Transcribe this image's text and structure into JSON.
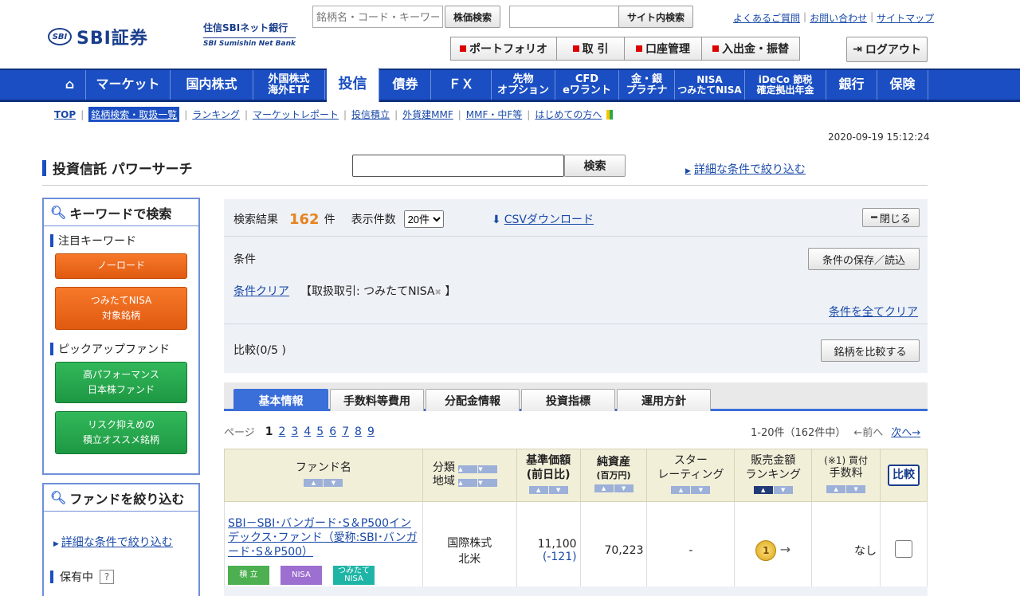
{
  "header": {
    "brand": "SBI証券",
    "brand_mark": "SBI",
    "bank_name": "住信SBIネット銀行",
    "bank_sub": "SBI Sumishin Net Bank",
    "stock_search_placeholder": "銘柄名・コード・キーワード",
    "stock_search_button": "株価検索",
    "site_search_button": "サイト内検索",
    "links": [
      "よくあるご質問",
      "お問い合わせ",
      "サイトマップ"
    ],
    "actions": [
      "ポートフォリオ",
      "取 引",
      "口座管理",
      "入出金・振替"
    ],
    "logout": "ログアウト"
  },
  "nav": {
    "items": [
      {
        "label": "マーケット"
      },
      {
        "label": "国内株式"
      },
      {
        "label": "外国株式\n海外ETF"
      },
      {
        "label": "投信"
      },
      {
        "label": "債券"
      },
      {
        "label": "ＦＸ"
      },
      {
        "label": "先物\nオプション"
      },
      {
        "label": "CFD\neワラント"
      },
      {
        "label": "金・銀\nプラチナ"
      },
      {
        "label": "NISA\nつみたてNISA"
      },
      {
        "label": "iDeCo 節税\n確定拠出年金"
      },
      {
        "label": "銀行"
      },
      {
        "label": "保険"
      }
    ],
    "sub": [
      "TOP",
      "銘柄検索・取扱一覧",
      "ランキング",
      "マーケットレポート",
      "投信積立",
      "外貨建MMF",
      "MMF・中F等",
      "はじめての方へ"
    ]
  },
  "timestamp": "2020-09-19 15:12:24",
  "page_title": "投資信託 パワーサーチ",
  "search_button": "検索",
  "detail_link": "詳細な条件で絞り込む",
  "left": {
    "keyword_title": "キーワードで検索",
    "hot_keywords": "注目キーワード",
    "orange_buttons": [
      "ノーロード",
      "つみたてNISA\n対象銘柄"
    ],
    "pickup": "ピックアップファンド",
    "green_buttons": [
      "高パフォーマンス\n日本株ファンド",
      "リスク抑えめの\n積立オススメ銘柄"
    ],
    "filter_title": "ファンドを絞り込む",
    "filter_link": "詳細な条件で絞り込む",
    "holding": "保有中",
    "holding_help": "?"
  },
  "conditions": {
    "result_label": "検索結果",
    "result_count": "162",
    "result_unit": "件",
    "per_page_label": "表示件数",
    "per_page_value": "20件",
    "csv": "CSVダウンロード",
    "close": "閉じる",
    "cond_label": "条件",
    "save_load": "条件の保存／読込",
    "clear": "条件クリア",
    "tag": "【取扱取引: つみたてNISA",
    "tag_end": "】",
    "clear_all": "条件を全てクリア",
    "compare_label": "比較(0/5 )",
    "compare_button": "銘柄を比較する"
  },
  "tabs": [
    "基本情報",
    "手数料等費用",
    "分配金情報",
    "投資指標",
    "運用方針"
  ],
  "pager": {
    "label": "ページ",
    "pages": [
      "1",
      "2",
      "3",
      "4",
      "5",
      "6",
      "7",
      "8",
      "9"
    ],
    "info": "1-20件（162件中）",
    "prev": "←前へ",
    "next": "次へ→"
  },
  "table": {
    "headers": {
      "fund": "ファンド名",
      "cat1": "分類",
      "cat2": "地域",
      "nav1": "基準価額",
      "nav2": "(前日比)",
      "assets1": "純資産",
      "assets2": "(百万円)",
      "star1": "スター",
      "star2": "レーティング",
      "rank1": "販売金額",
      "rank2": "ランキング",
      "fee1": "(※1) 買付",
      "fee2": "手数料",
      "compare": "比較"
    },
    "rows": [
      {
        "fund": "SBI－SBI･バンガード･S＆P500インデックス･ファンド（愛称:SBI･バンガード･S＆P500）",
        "badges": [
          "積 立",
          "NISA",
          "つみたて\nNISA"
        ],
        "cat": "国際株式",
        "region": "北米",
        "nav": "11,100",
        "change": "(-121)",
        "assets": "70,223",
        "star": "-",
        "rank": "1",
        "trend": "→",
        "fee": "なし"
      }
    ]
  },
  "colors": {
    "nav_blue": "#1a4ec2",
    "orange": "#e8831f",
    "green": "#1e9843",
    "badge_tsumitate": "#4caf50",
    "badge_nisa": "#9c6fd0",
    "badge_tnisa": "#1fb5a6"
  }
}
